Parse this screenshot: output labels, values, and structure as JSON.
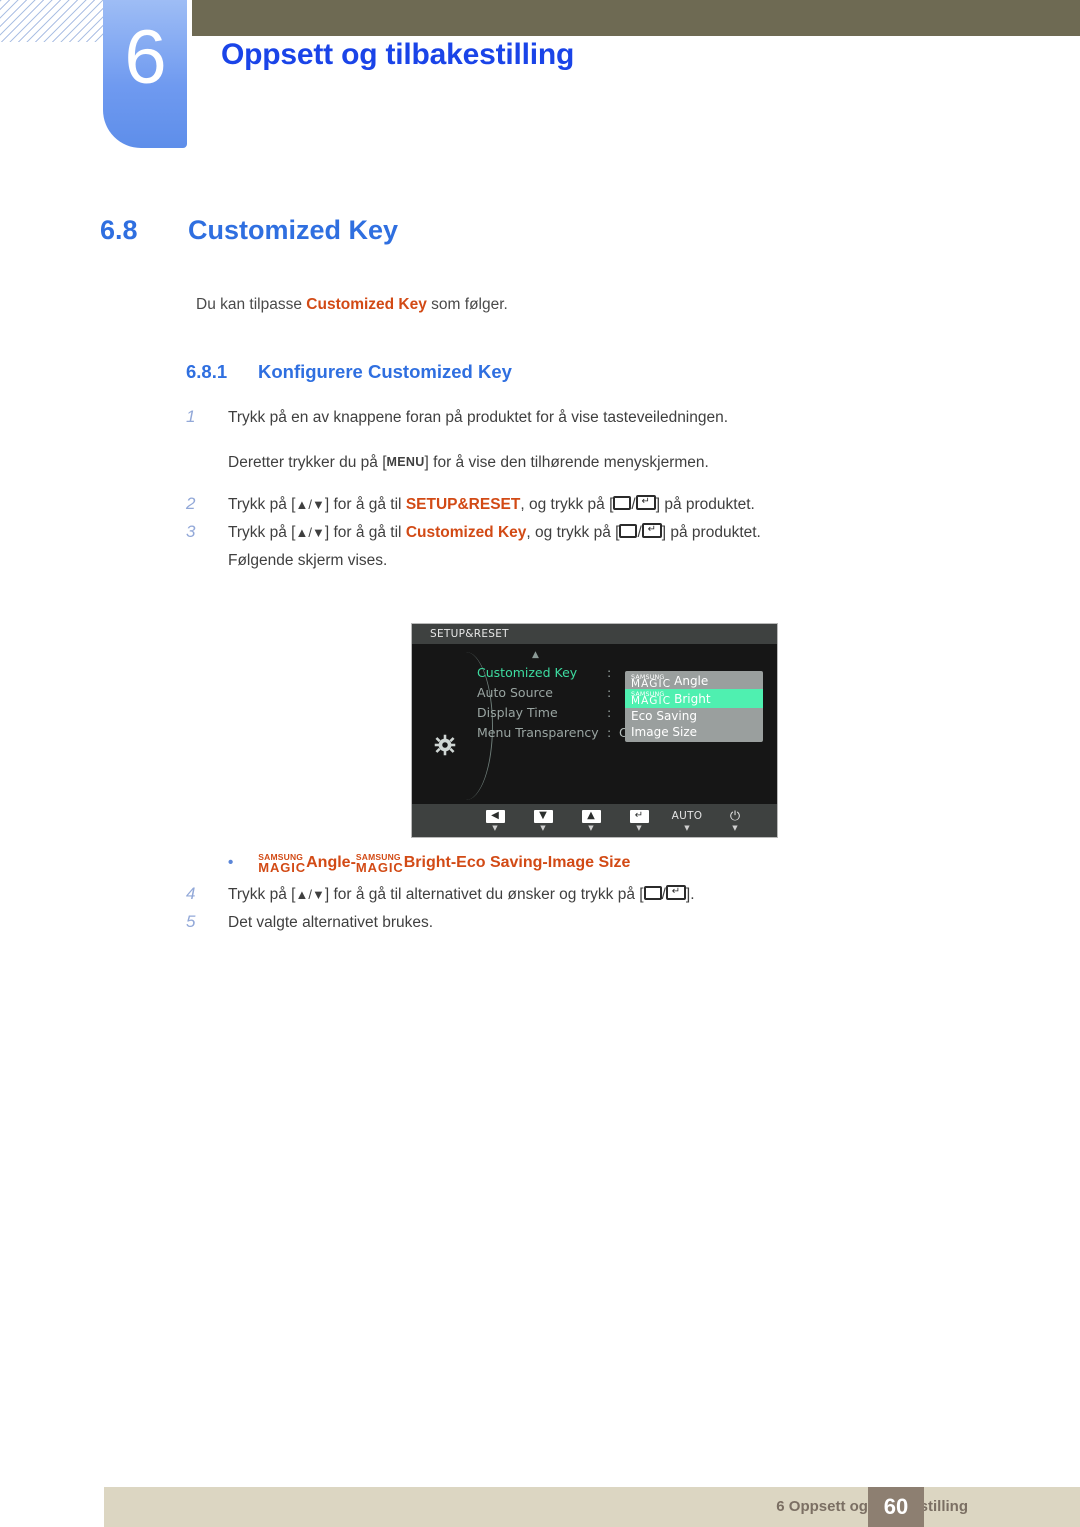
{
  "header": {
    "chapter_number": "6",
    "chapter_title": "Oppsett og tilbakestilling"
  },
  "section": {
    "number": "6.8",
    "title": "Customized Key",
    "intro_prefix": "Du kan tilpasse ",
    "intro_keyword": "Customized Key",
    "intro_suffix": " som følger."
  },
  "subsection": {
    "number": "6.8.1",
    "title": "Konfigurere Customized Key"
  },
  "steps": [
    {
      "num": "1",
      "text": "Trykk på en av knappene foran på produktet for å vise tasteveiledningen."
    },
    {
      "num": "2",
      "prefix": "Trykk på [",
      "keys": "▲/▼",
      "mid": "] for å gå til ",
      "keyword": "SETUP&RESET",
      "mid2": ", og trykk på [",
      "suffix": "] på produktet."
    },
    {
      "num": "3",
      "prefix": "Trykk på [",
      "keys": "▲/▼",
      "mid": "] for å gå til ",
      "keyword": "Customized Key",
      "mid2": ", og trykk på [",
      "suffix": "] på produktet."
    },
    {
      "num": "4",
      "prefix": "Trykk på [",
      "keys": "▲/▼",
      "mid": "] for å gå til alternativet du ønsker og trykk på [",
      "suffix": "]."
    },
    {
      "num": "5",
      "text": "Det valgte alternativet brukes."
    }
  ],
  "step1_followup_prefix": "Deretter trykker du på [",
  "step1_menu_key": "MENU",
  "step1_followup_suffix": "] for å vise den tilhørende menyskjermen.",
  "step3_followup": "Følgende skjerm vises.",
  "osd": {
    "title": "SETUP&RESET",
    "up_arrow": "▲",
    "rows": [
      {
        "label": "Customized Key",
        "colon": ":",
        "value": "",
        "active": true
      },
      {
        "label": "Auto Source",
        "colon": ":",
        "value": "",
        "active": false
      },
      {
        "label": "Display Time",
        "colon": ":",
        "value": "",
        "active": false
      },
      {
        "label": "Menu Transparency",
        "colon": ":",
        "value": "On",
        "active": false
      }
    ],
    "dropdown": [
      {
        "brand_top": "SAMSUNG",
        "brand_bottom": "MAGIC",
        "label": "Angle",
        "selected": false
      },
      {
        "brand_top": "SAMSUNG",
        "brand_bottom": "MAGIC",
        "label": "Bright",
        "selected": true
      },
      {
        "brand_top": "",
        "brand_bottom": "",
        "label": "Eco Saving",
        "selected": false
      },
      {
        "brand_top": "",
        "brand_bottom": "",
        "label": "Image Size",
        "selected": false
      }
    ],
    "footer_buttons": [
      {
        "glyph": "◀",
        "tick": "▼",
        "kind": "left"
      },
      {
        "glyph": "▼",
        "tick": "▼",
        "kind": "down"
      },
      {
        "glyph": "▲",
        "tick": "▼",
        "kind": "up"
      },
      {
        "glyph": "↵",
        "tick": "▼",
        "kind": "enter"
      },
      {
        "glyph": "AUTO",
        "tick": "▼",
        "kind": "auto"
      },
      {
        "glyph": "⏻",
        "tick": "▼",
        "kind": "power"
      }
    ],
    "colors": {
      "background": "#151515",
      "titlebar": "#3e4140",
      "active_item": "#3ddca0",
      "dropdown_bg": "#9a9f9e",
      "dropdown_selected": "#4ff0b0"
    }
  },
  "bullet": {
    "dot": "•",
    "brand_top": "SAMSUNG",
    "brand_bottom": "MAGIC",
    "item1": "Angle",
    "sep1": " - ",
    "brand2_top": "SAMSUNG",
    "brand2_bottom": "MAGIC",
    "item2": "Bright",
    "sep2": " - ",
    "item3": "Eco Saving",
    "sep3": " - ",
    "item4": "Image Size"
  },
  "footer": {
    "text": "6 Oppsett og tilbakestilling",
    "page": "60"
  },
  "theme": {
    "heading_blue": "#2f6fe0",
    "title_blue": "#1a44e8",
    "keyword_orange": "#d24a15",
    "olive": "#6e6a53",
    "footer_beige": "#dcd6c2",
    "footer_badge": "#8d7f71"
  }
}
